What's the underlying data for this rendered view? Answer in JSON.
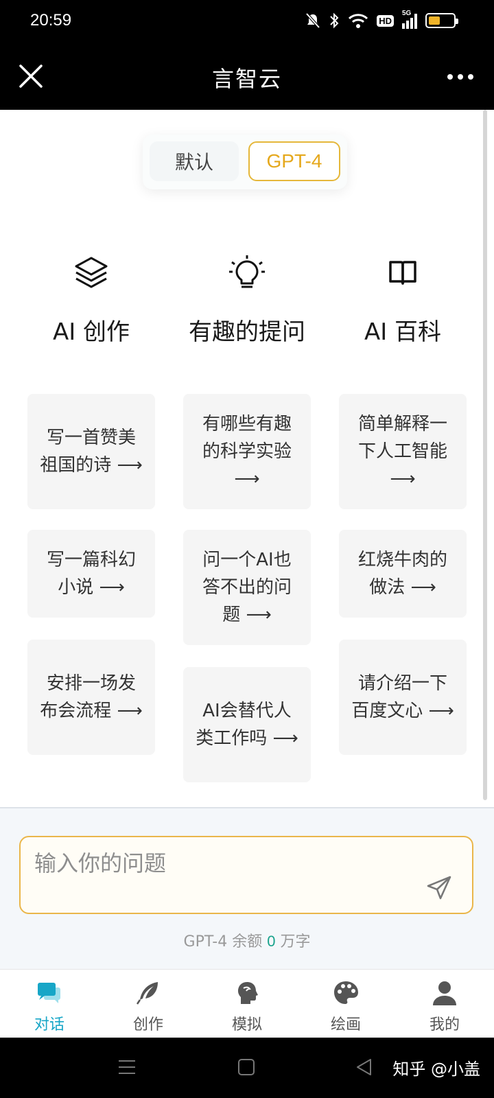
{
  "status_bar": {
    "time": "20:59",
    "network": "5G",
    "hd": "HD"
  },
  "app": {
    "title": "言智云"
  },
  "mode_toggle": {
    "options": [
      "默认",
      "GPT-4"
    ],
    "selected": "GPT-4"
  },
  "categories": [
    {
      "icon": "layers-icon",
      "label": "AI 创作"
    },
    {
      "icon": "lightbulb-icon",
      "label": "有趣的提问"
    },
    {
      "icon": "book-icon",
      "label": "AI 百科"
    }
  ],
  "prompts": {
    "col1": [
      "写一首赞美祖国的诗 ⟶",
      "写一篇科幻小说 ⟶",
      "安排一场发布会流程 ⟶"
    ],
    "col2": [
      "有哪些有趣的科学实验 ⟶",
      "问一个AI也答不出的问题 ⟶",
      "AI会替代人类工作吗 ⟶"
    ],
    "col3": [
      "简单解释一下人工智能 ⟶",
      "红烧牛肉的做法 ⟶",
      "请介绍一下百度文心 ⟶"
    ]
  },
  "input": {
    "placeholder": "输入你的问题"
  },
  "quota": {
    "prefix": "GPT-4 余额",
    "value": "0",
    "suffix": "万字"
  },
  "tabbar": {
    "items": [
      {
        "label": "对话",
        "icon": "chat-icon",
        "active": true
      },
      {
        "label": "创作",
        "icon": "feather-icon",
        "active": false
      },
      {
        "label": "模拟",
        "icon": "head-profile-icon",
        "active": false
      },
      {
        "label": "绘画",
        "icon": "palette-icon",
        "active": false
      },
      {
        "label": "我的",
        "icon": "user-icon",
        "active": false
      }
    ]
  },
  "watermark": "知乎 @小盖",
  "colors": {
    "accent": "#e5a81c",
    "active_tab": "#17a6c7",
    "quota_value": "#19a38c"
  }
}
